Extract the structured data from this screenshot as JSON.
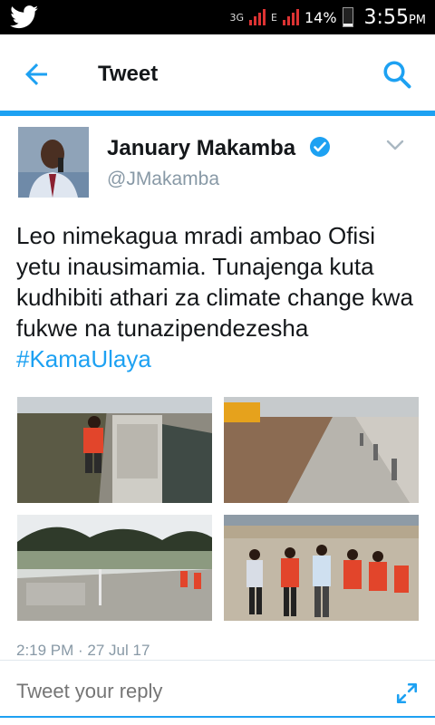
{
  "status_bar": {
    "network_3g": "3G",
    "network_e": "E",
    "battery_percent": "14%",
    "time": "3:55",
    "ampm": "PM"
  },
  "app_bar": {
    "title": "Tweet",
    "back_icon": "back-arrow-icon",
    "search_icon": "search-icon"
  },
  "tweet": {
    "author_name": "January Makamba",
    "author_handle": "@JMakamba",
    "verified": true,
    "text": "Leo nimekagua mradi ambao Ofisi yetu inausimamia. Tunajenga kuta kudhibiti athari za climate change kwa fukwe na tunazipendezesha ",
    "hashtag": "#KamaUlaya",
    "timestamp": "2:19 PM · 27 Jul 17",
    "media_count": 4
  },
  "reply": {
    "placeholder": "Tweet your reply"
  },
  "colors": {
    "accent": "#1da1f2",
    "text": "#14171a",
    "muted": "#8899a6"
  }
}
